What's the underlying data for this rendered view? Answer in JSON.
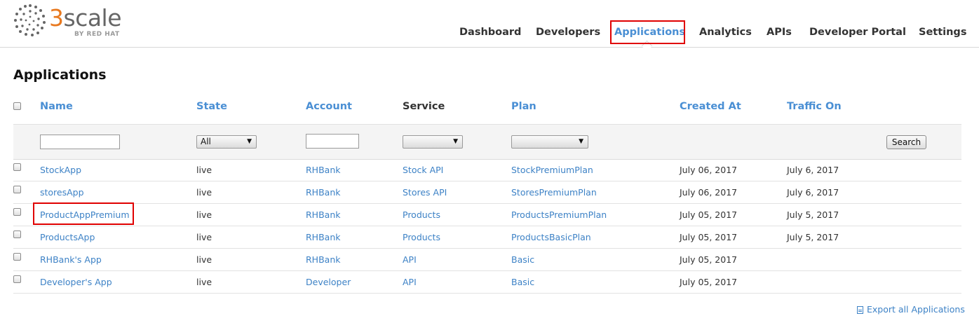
{
  "brand": {
    "name_digit": "3",
    "name_rest": "scale",
    "tagline": "BY RED HAT",
    "accent": "#e8791f"
  },
  "nav": [
    {
      "label": "Dashboard",
      "active": false
    },
    {
      "label": "Developers",
      "active": false
    },
    {
      "label": "Applications",
      "active": true
    },
    {
      "label": "Analytics",
      "active": false
    },
    {
      "label": "APIs",
      "active": false
    },
    {
      "label": "Developer Portal",
      "active": false
    },
    {
      "label": "Settings",
      "active": false
    }
  ],
  "page": {
    "title": "Applications"
  },
  "table": {
    "headers": [
      "Name",
      "State",
      "Account",
      "Service",
      "Plan",
      "Created At",
      "Traffic On"
    ],
    "filters": {
      "name_value": "",
      "state_selected": "All",
      "account_value": "",
      "service_selected": "",
      "plan_selected": "",
      "search_label": "Search"
    },
    "rows": [
      {
        "name": "StockApp",
        "state": "live",
        "account": "RHBank",
        "service": "Stock API",
        "plan": "StockPremiumPlan",
        "created_at": "July 06, 2017",
        "traffic_on": "July 6, 2017"
      },
      {
        "name": "storesApp",
        "state": "live",
        "account": "RHBank",
        "service": "Stores API",
        "plan": "StoresPremiumPlan",
        "created_at": "July 06, 2017",
        "traffic_on": "July 6, 2017"
      },
      {
        "name": "ProductAppPremium",
        "state": "live",
        "account": "RHBank",
        "service": "Products",
        "plan": "ProductsPremiumPlan",
        "created_at": "July 05, 2017",
        "traffic_on": "July 5, 2017"
      },
      {
        "name": "ProductsApp",
        "state": "live",
        "account": "RHBank",
        "service": "Products",
        "plan": "ProductsBasicPlan",
        "created_at": "July 05, 2017",
        "traffic_on": "July 5, 2017"
      },
      {
        "name": "RHBank's App",
        "state": "live",
        "account": "RHBank",
        "service": "API",
        "plan": "Basic",
        "created_at": "July 05, 2017",
        "traffic_on": ""
      },
      {
        "name": "Developer's App",
        "state": "live",
        "account": "Developer",
        "service": "API",
        "plan": "Basic",
        "created_at": "July 05, 2017",
        "traffic_on": ""
      }
    ]
  },
  "export": {
    "label": "Export all Applications",
    "icon": "spreadsheet-icon"
  },
  "colors": {
    "link": "#3d82c6",
    "header_link": "#4a8fd4",
    "highlight_box": "#e00000"
  }
}
